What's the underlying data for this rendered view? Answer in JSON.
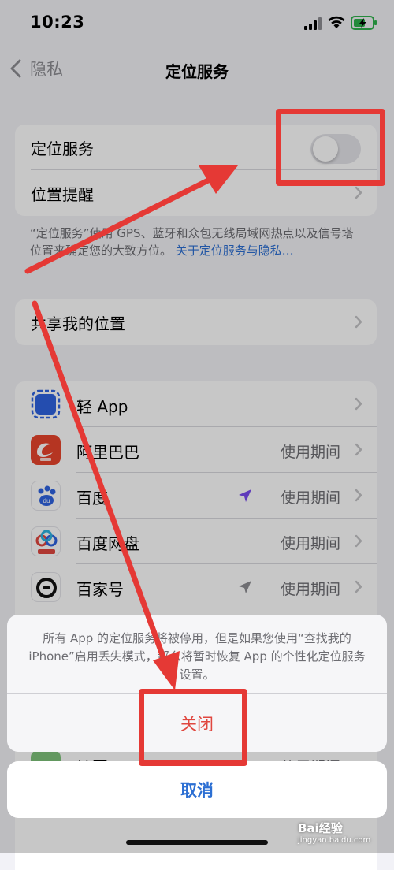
{
  "status_bar": {
    "time": "10:23"
  },
  "nav": {
    "back_label": "隐私",
    "title": "定位服务"
  },
  "location_group": {
    "location_services_label": "定位服务",
    "location_services_on": false,
    "location_alerts_label": "位置提醒"
  },
  "footnote": {
    "text": "“定位服务”使用 GPS、蓝牙和众包无线局域网热点以及信号塔位置来确定您的大致方位。",
    "link": "关于定位服务与隐私…"
  },
  "share_location_label": "共享我的位置",
  "apps": [
    {
      "name": "轻 App",
      "value": "",
      "arrow": "none"
    },
    {
      "name": "阿里巴巴",
      "value": "使用期间",
      "arrow": "none"
    },
    {
      "name": "百度",
      "value": "使用期间",
      "arrow": "purple"
    },
    {
      "name": "百度网盘",
      "value": "使用期间",
      "arrow": "none"
    },
    {
      "name": "百家号",
      "value": "使用期间",
      "arrow": "gray"
    }
  ],
  "partial_rows": {
    "maps_label": "地图",
    "maps_value": "使用期间"
  },
  "action_sheet": {
    "message": "所有 App 的定位服务将被停用，但是如果您使用“查找我的 iPhone”启用丢失模式，那么将暂时恢复 App 的个性化定位服务设置。",
    "destructive_label": "关闭",
    "cancel_label": "取消"
  },
  "watermark": {
    "brand": "Bai经验",
    "url": "jingyan.baidu.com"
  },
  "colors": {
    "annotation": "#e53935",
    "link": "#2c6fd3",
    "destructive": "#e0473f",
    "purple_arrow": "#7a4cf0"
  }
}
